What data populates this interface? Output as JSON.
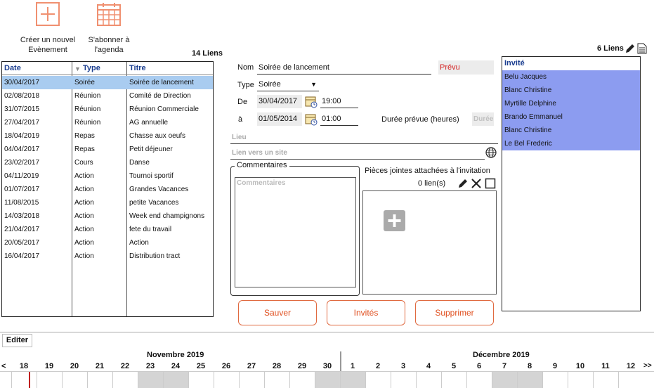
{
  "toolbar": {
    "new_event_line1": "Créer un nouvel",
    "new_event_line2": "Evènement",
    "subscribe_line1": "S'abonner à",
    "subscribe_line2": "l'agenda",
    "accent": "#f09070"
  },
  "events": {
    "count_label": "14 Liens",
    "headers": {
      "date": "Date",
      "type": "Type",
      "title": "Titre"
    },
    "rows": [
      {
        "date": "30/04/2017",
        "type": "Soirée",
        "title": "Soirée de lancement",
        "selected": true
      },
      {
        "date": "02/08/2018",
        "type": "Réunion",
        "title": "Comité de Direction"
      },
      {
        "date": "31/07/2015",
        "type": "Réunion",
        "title": "Réunion Commerciale"
      },
      {
        "date": "27/04/2017",
        "type": "Réunion",
        "title": "AG annuelle"
      },
      {
        "date": "18/04/2019",
        "type": "Repas",
        "title": "Chasse aux oeufs"
      },
      {
        "date": "04/04/2017",
        "type": "Repas",
        "title": "Petit déjeuner"
      },
      {
        "date": "23/02/2017",
        "type": "Cours",
        "title": "Danse"
      },
      {
        "date": "04/11/2019",
        "type": "Action",
        "title": "Tournoi sportif"
      },
      {
        "date": "01/07/2017",
        "type": "Action",
        "title": "Grandes Vacances"
      },
      {
        "date": "11/08/2015",
        "type": "Action",
        "title": "petite Vacances"
      },
      {
        "date": "14/03/2018",
        "type": "Action",
        "title": "Week end champignons"
      },
      {
        "date": "21/04/2017",
        "type": "Action",
        "title": "fete du travail"
      },
      {
        "date": "20/05/2017",
        "type": "Action",
        "title": "Action"
      },
      {
        "date": "16/04/2017",
        "type": "Action",
        "title": "Distribution tract"
      }
    ]
  },
  "form": {
    "nom_label": "Nom",
    "nom_value": "Soirée de lancement",
    "status": "Prévu",
    "type_label": "Type",
    "type_value": "Soirée",
    "de_label": "De",
    "start_date": "30/04/2017",
    "start_time": "19:00",
    "a_label": "à",
    "end_date": "01/05/2014",
    "end_time": "01:00",
    "duration_label": "Durée prévue (heures)",
    "duration_placeholder": "Durée",
    "lieu_placeholder": "Lieu",
    "link_placeholder": "Lien vers un site",
    "comments_title": "Commentaires",
    "comments_placeholder": "Commentaires",
    "attachments_title": "Pièces jointes attachées à l'invitation",
    "attachments_count": "0 lien(s)"
  },
  "actions": {
    "save": "Sauver",
    "invited": "Invités",
    "delete": "Supprimer"
  },
  "invitees": {
    "count_label": "6 Liens",
    "header": "Invité",
    "items": [
      "Belu Jacques",
      "Blanc Christine",
      "Myrtille Delphine",
      "Brando Emmanuel",
      "Blanc Christine",
      "Le Bel Frederic"
    ]
  },
  "calendar": {
    "edit_label": "Editer",
    "prev": "<",
    "next": ">>",
    "month1": "Novembre 2019",
    "month2": "Décembre 2019",
    "days": [
      "18",
      "19",
      "20",
      "21",
      "22",
      "23",
      "24",
      "25",
      "26",
      "27",
      "28",
      "29",
      "30",
      "1",
      "2",
      "3",
      "4",
      "5",
      "6",
      "7",
      "8",
      "9",
      "10",
      "11",
      "12"
    ],
    "weekend_days": [
      "23",
      "24",
      "30",
      "1",
      "7",
      "8"
    ],
    "today": "18"
  }
}
